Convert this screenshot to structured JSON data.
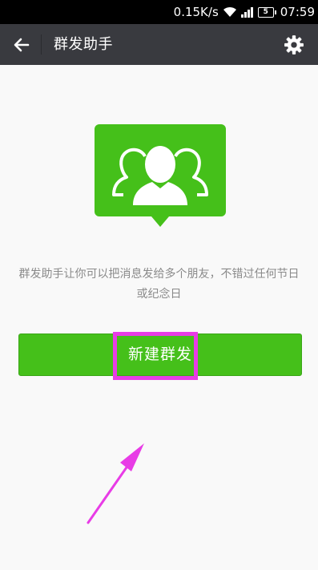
{
  "status_bar": {
    "network_speed": "0.15K/s",
    "battery": "5",
    "time": "07:59"
  },
  "header": {
    "title": "群发助手"
  },
  "main": {
    "description": "群发助手让你可以把消息发给多个朋友，不错过任何节日或纪念日",
    "new_button_label": "新建群发"
  },
  "colors": {
    "status_bar": "#000000",
    "action_bar": "#393a3f",
    "brand_green": "#45c01a",
    "highlight_magenta": "#e83ce6",
    "description_gray": "#8a8a8a"
  },
  "icons": [
    "back-arrow-icon",
    "settings-gear-icon",
    "wifi-icon",
    "signal-icon",
    "battery-icon",
    "group-chat-icon"
  ]
}
